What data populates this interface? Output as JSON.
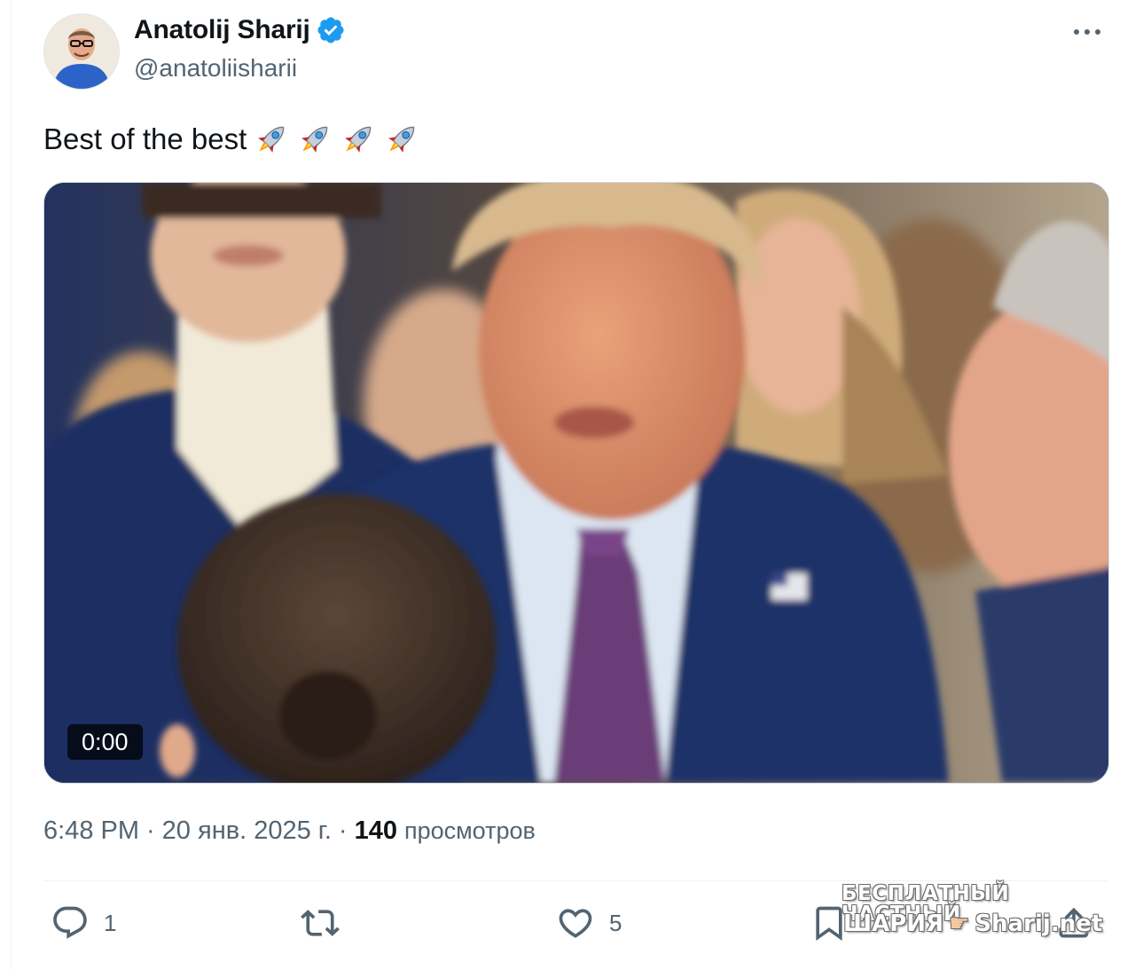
{
  "author": {
    "display_name": "Anatolij Sharij",
    "handle": "@anatoliisharii",
    "verified": true,
    "avatar_icon": "avatar-portrait"
  },
  "tweet": {
    "text": "Best of the best",
    "emoji": [
      "rocket",
      "rocket",
      "rocket",
      "rocket"
    ]
  },
  "media": {
    "type": "video",
    "duration": "0:00"
  },
  "meta": {
    "time": "6:48 PM",
    "separator": "·",
    "date": "20 янв. 2025 г.",
    "views_count": "140",
    "views_label": "просмотров"
  },
  "actions": {
    "reply_count": "1",
    "retweet_count": "",
    "like_count": "5"
  },
  "watermark": {
    "line1": "БЕСПЛАТНЫЙ ЧАСТНЫЙ",
    "line2_left": "ШАРИЯ",
    "line2_right": "Sharij.net"
  },
  "colors": {
    "verified_blue": "#1d9bf0",
    "secondary_text": "#536471",
    "primary_text": "#0f1419"
  }
}
